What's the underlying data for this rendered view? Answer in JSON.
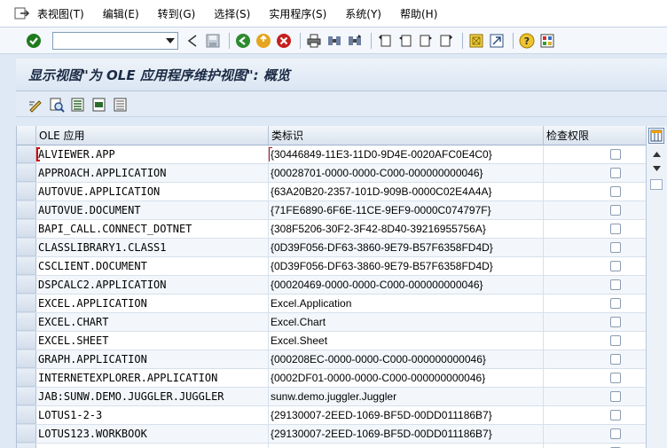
{
  "menu": {
    "items": [
      "表视图(T)",
      "编辑(E)",
      "转到(G)",
      "选择(S)",
      "实用程序(S)",
      "系统(Y)",
      "帮助(H)"
    ]
  },
  "toolbar": {
    "command_value": "",
    "icons": [
      "enter-check-icon",
      "back-icon",
      "save-icon",
      "back-green-icon",
      "exit-icon",
      "cancel-icon",
      "print-icon",
      "find-icon",
      "find-next-icon",
      "first-page-icon",
      "previous-page-icon",
      "next-page-icon",
      "last-page-icon",
      "create-session-icon",
      "shortcut-icon",
      "help-icon",
      "layout-icon"
    ]
  },
  "title": "显示视图\"为 OLE 应用程序维护视图\": 概览",
  "table": {
    "headers": {
      "ole_app": "OLE 应用",
      "clsid": "类标识",
      "check": "检查权限"
    },
    "rows": [
      {
        "ole": "ALVIEWER.APP",
        "clsid": "{30446849-11E3-11D0-9D4E-0020AFC0E4C0}",
        "checked": false
      },
      {
        "ole": "APPROACH.APPLICATION",
        "clsid": "{00028701-0000-0000-C000-000000000046}",
        "checked": false
      },
      {
        "ole": "AUTOVUE.APPLICATION",
        "clsid": "{63A20B20-2357-101D-909B-0000C02E4A4A}",
        "checked": false
      },
      {
        "ole": "AUTOVUE.DOCUMENT",
        "clsid": "{71FE6890-6F6E-11CE-9EF9-0000C074797F}",
        "checked": false
      },
      {
        "ole": "BAPI_CALL.CONNECT_DOTNET",
        "clsid": "{308F5206-30F2-3F42-8D40-39216955756A}",
        "checked": false
      },
      {
        "ole": "CLASSLIBRARY1.CLASS1",
        "clsid": "{0D39F056-DF63-3860-9E79-B57F6358FD4D}",
        "checked": false
      },
      {
        "ole": "CSCLIENT.DOCUMENT",
        "clsid": "{0D39F056-DF63-3860-9E79-B57F6358FD4D}",
        "checked": false
      },
      {
        "ole": "DSPCALC2.APPLICATION",
        "clsid": "{00020469-0000-0000-C000-000000000046}",
        "checked": false
      },
      {
        "ole": "EXCEL.APPLICATION",
        "clsid": "Excel.Application",
        "checked": false
      },
      {
        "ole": "EXCEL.CHART",
        "clsid": "Excel.Chart",
        "checked": false
      },
      {
        "ole": "EXCEL.SHEET",
        "clsid": "Excel.Sheet",
        "checked": false
      },
      {
        "ole": "GRAPH.APPLICATION",
        "clsid": "{000208EC-0000-0000-C000-000000000046}",
        "checked": false
      },
      {
        "ole": "INTERNETEXPLORER.APPLICATION",
        "clsid": "{0002DF01-0000-0000-C000-000000000046}",
        "checked": false
      },
      {
        "ole": "JAB:SUNW.DEMO.JUGGLER.JUGGLER",
        "clsid": "sunw.demo.juggler.Juggler",
        "checked": false
      },
      {
        "ole": "LOTUS1-2-3",
        "clsid": "{29130007-2EED-1069-BF5D-00DD011186B7}",
        "checked": false
      },
      {
        "ole": "LOTUS123.WORKBOOK",
        "clsid": "{29130007-2EED-1069-BF5D-00DD011186B7}",
        "checked": false
      },
      {
        "ole": "",
        "clsid": "",
        "checked": false
      }
    ]
  },
  "colors": {
    "accent": "#d20000",
    "header_bg": "#dfe9f5"
  }
}
